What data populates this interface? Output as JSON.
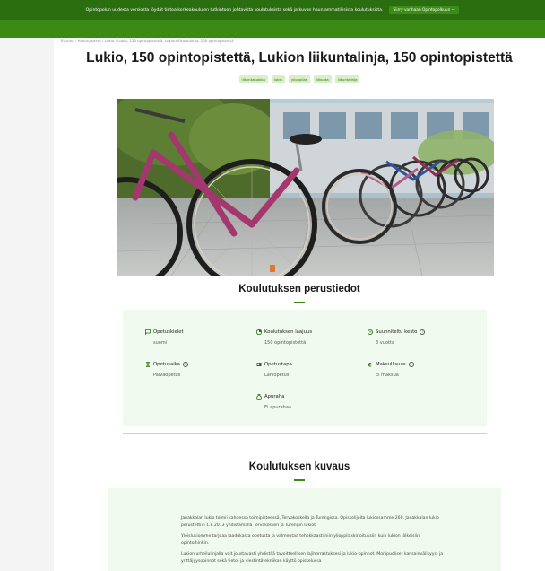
{
  "banner": {
    "message": "Opintopolun uudesta versiosta löydät tietoa korkeakoulujen tutkintoon johtavista koulutuksista sekä jatkuvan haun ammatillisista koulutuksista.",
    "button_label": "Siirry vanhaan Opintopolkuun →"
  },
  "breadcrumb": "Etusivu  /  Hakutulokset  /  Lukio  /  Lukio, 150 opintopistettä, Lukion liikuntalinja, 150 opintopistettä",
  "page_title": "Lukio, 150 opintopistettä, Lukion liikuntalinja, 150 opintopistettä",
  "tags": [
    "liikuntaluokka",
    "lukio",
    "ylioppilas",
    "liikunta",
    "liikuntalinja"
  ],
  "basics": {
    "heading": "Koulutuksen perustiedot",
    "items": [
      {
        "label": "Opetuskielet",
        "value": "suomi",
        "icon": "flag-icon",
        "info": false
      },
      {
        "label": "Koulutuksen laajuus",
        "value": "150 opintopistettä",
        "icon": "pie-icon",
        "info": false
      },
      {
        "label": "Suunniteltu kesto",
        "value": "3 vuotta",
        "icon": "clock-icon",
        "info": true
      },
      {
        "label": "Opetusaika",
        "value": "Päiväopetus",
        "icon": "hourglass-icon",
        "info": true
      },
      {
        "label": "Opetustapa",
        "value": "Lähiopetus",
        "icon": "classroom-icon",
        "info": false
      },
      {
        "label": "Maksullisuus",
        "value": "Ei maksua",
        "icon": "euro-icon",
        "info": true
      },
      {
        "label": "Apuraha",
        "value": "Ei apurahaa",
        "icon": "moneybag-icon",
        "info": false
      }
    ]
  },
  "description": {
    "heading": "Koulutuksen kuvaus",
    "paragraphs": [
      "Janakkalan lukio toimii kahdessa toimipisteessä, Tervakoskella ja Turengissa. Opiskelijoita lukiossamme 260. Janakkalan lukio perustettiin 1.8.2013 yhdistämällä Tervakosken ja Turengin lukiot.",
      "Yleislukiomme tarjoaa laadukasta opetusta ja valmentaa tehokkaasti niin ylioppilaskirjoituksiin kuin lukion jälkeisiin opintoihinkin.",
      "Lukion urheilulinjalla voit joustavasti yhdistää tavoitteellisen lajiharrastuksesi ja lukio-opinnot. Monipuoliset kansainvälisyys- ja yrittäjyysopinnot sekä tieto- ja viestintätekniikan käyttö opiskelussa"
    ]
  },
  "colors": {
    "brand_green": "#3a8a14",
    "dark_green": "#2b6e0f",
    "light_green_bg": "#f1faee",
    "tag_bg": "#d7f0c8"
  }
}
